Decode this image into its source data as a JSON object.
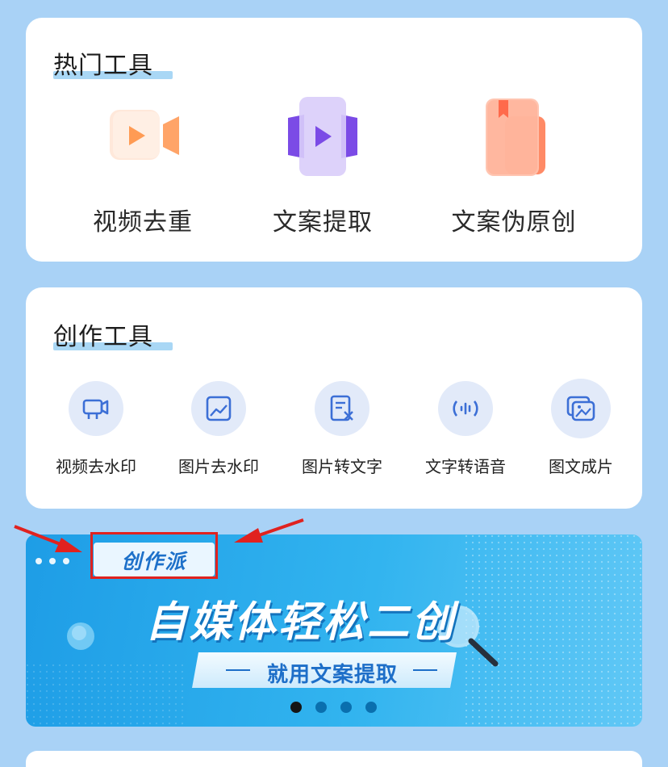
{
  "hot_tools": {
    "title": "热门工具",
    "items": [
      {
        "label": "视频去重",
        "icon": "video-camera-icon"
      },
      {
        "label": "文案提取",
        "icon": "video-play-icon"
      },
      {
        "label": "文案伪原创",
        "icon": "bookmark-book-icon"
      }
    ]
  },
  "create_tools": {
    "title": "创作工具",
    "items": [
      {
        "label": "视频去水印",
        "icon": "video-watermark-icon"
      },
      {
        "label": "图片去水印",
        "icon": "image-icon"
      },
      {
        "label": "图片转文字",
        "icon": "image-to-text-icon"
      },
      {
        "label": "文字转语音",
        "icon": "audio-wave-icon"
      },
      {
        "label": "图文成片",
        "icon": "gallery-icon"
      }
    ]
  },
  "banner": {
    "tag": "创作派",
    "headline": "自媒体轻松二创",
    "subline": "就用文案提取",
    "slides": 4,
    "active_slide": 1
  },
  "colors": {
    "page_bg": "#a9d2f6",
    "banner_blue": "#1e9de6",
    "annotation_red": "#e0221f"
  }
}
